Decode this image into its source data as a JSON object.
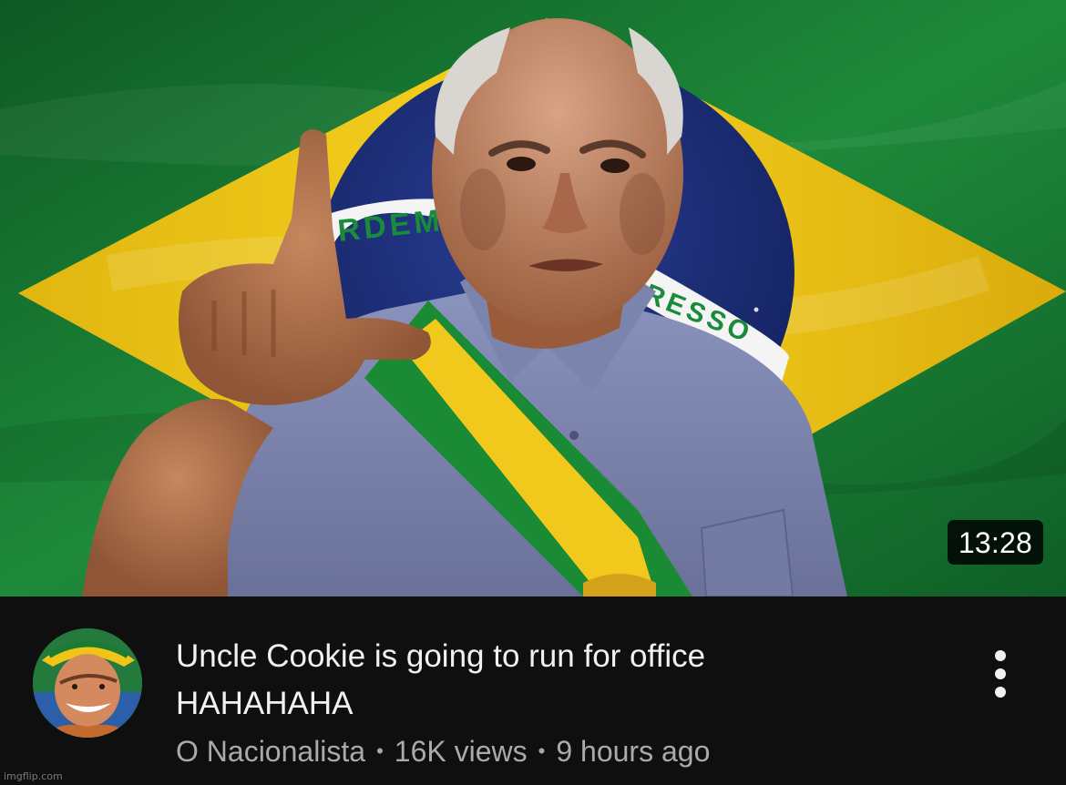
{
  "video": {
    "duration": "13:28",
    "title": "Uncle Cookie is going to run for office\nHAHAHAHA",
    "channel": "O Nacionalista",
    "views": "16K views",
    "age": "9 hours ago",
    "separator": "•"
  },
  "thumbnail": {
    "flag_motto_left": "RDEM",
    "flag_motto_right": "RESSO",
    "colors": {
      "flag_green": "#1c7a33",
      "flag_yellow": "#f2cc1a",
      "flag_blue": "#1c2f7a",
      "shirt": "#7d86b0",
      "skin": "#b07350"
    }
  },
  "menu": {
    "icon": "more-vert-icon"
  },
  "watermark": "imgflip.com"
}
